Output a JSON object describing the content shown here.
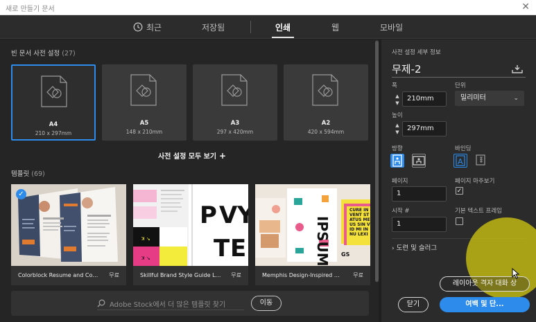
{
  "window": {
    "title": "새로 만들기 문서",
    "close": "✕"
  },
  "tabs": [
    {
      "label": "최근"
    },
    {
      "label": "저장됨"
    },
    {
      "label": "인쇄"
    },
    {
      "label": "웹"
    },
    {
      "label": "모바일"
    }
  ],
  "presets_section": {
    "title": "빈 문서 사전 설정",
    "count": "(27)"
  },
  "presets": [
    {
      "name": "A4",
      "size": "210 x 297mm"
    },
    {
      "name": "A5",
      "size": "148 x 210mm"
    },
    {
      "name": "A3",
      "size": "297 x 420mm"
    },
    {
      "name": "A2",
      "size": "420 x 594mm"
    }
  ],
  "view_all": {
    "label": "사전 설정 모두 보기",
    "icon": "+"
  },
  "templates_section": {
    "title": "템플릿",
    "count": "(69)"
  },
  "templates": [
    {
      "name": "Colorblock Resume and Cover L...",
      "price": "무료"
    },
    {
      "name": "Skillful Brand Style Guide Layout",
      "price": "무료"
    },
    {
      "name": "Memphis Design-Inspired Magaz...",
      "price": "무료"
    }
  ],
  "template_thumb_text": {
    "brand_glyphs": [
      "P",
      "V",
      "Y",
      "T",
      "E"
    ],
    "brand_small": "ꓘ ↘",
    "memphis_word": "IPSUM",
    "memphis_side": "CURE INVENT STATUS ME US SIN VID MI IN NU LEXI",
    "memphis_small": "GS"
  },
  "stock_search": {
    "placeholder": "Adobe Stock에서 더 많은 템플릿 찾기",
    "button": "이동"
  },
  "details": {
    "header": "사전 설정 세부 정보",
    "doc_name": "무제-2",
    "width_label": "폭",
    "width_value": "210mm",
    "units_label": "단위",
    "units_value": "밀리미터",
    "height_label": "높이",
    "height_value": "297mm",
    "orientation_label": "방향",
    "binding_label": "바인딩",
    "pages_label": "페이지",
    "pages_value": "1",
    "facing_label": "페이지 마주보기",
    "facing_checked": true,
    "start_label": "시작 #",
    "start_value": "1",
    "primary_frame_label": "기본 텍스트 프레임",
    "primary_frame_checked": false,
    "bleed_label": "도련 및 슬러그"
  },
  "buttons": {
    "layout_grid": "레이아웃 격자 대화 상",
    "close": "닫기",
    "margins": "여백 및 단..."
  },
  "colors": {
    "accent": "#2d8ceb",
    "highlight": "#cdc412"
  }
}
